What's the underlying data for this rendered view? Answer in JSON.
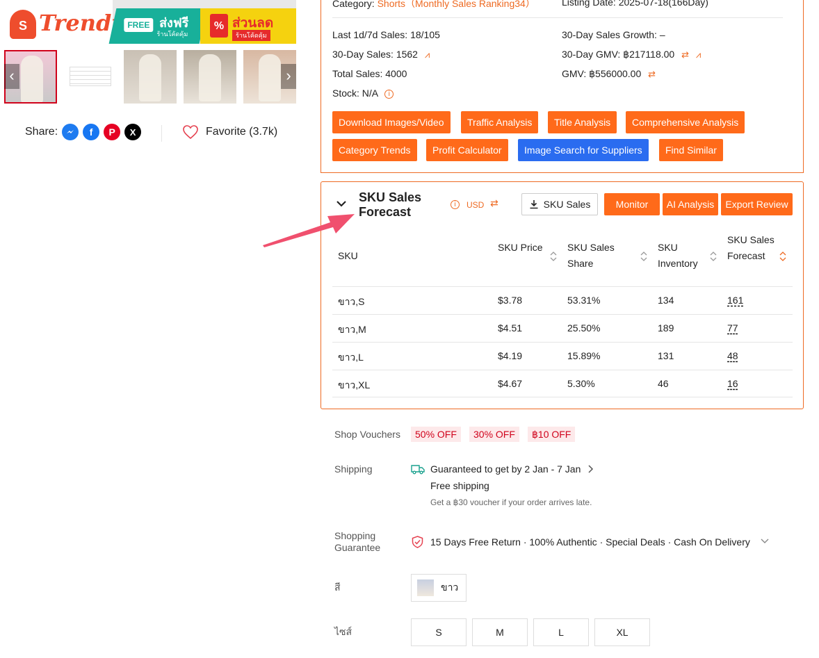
{
  "banner": {
    "brand_badge": "S",
    "brand_name": "Trendy",
    "free_tag": "FREE",
    "free_text": "ส่งฟรี",
    "free_sub": "ร้านโค้ดคุ้ม",
    "sale_icon": "%",
    "sale_text": "ส่วนลด",
    "sale_sub": "ร้านโค้ดคุ้ม"
  },
  "gallery": {
    "prev_icon": "chevron-left-icon",
    "next_icon": "chevron-right-icon",
    "prev_glyph": "‹",
    "next_glyph": "›"
  },
  "share": {
    "label": "Share:",
    "icons": [
      "messenger-icon",
      "facebook-icon",
      "pinterest-icon",
      "x-icon"
    ],
    "facebook_glyph": "f",
    "pinterest_glyph": "P",
    "x_glyph": "X"
  },
  "favorite": {
    "label": "Favorite (3.7k)"
  },
  "stats": {
    "category_label": "Category:",
    "category_value": "Shorts（Monthly Sales Ranking34）",
    "listing_label": "Listing Date:",
    "listing_value": "2025-07-18(166Day)",
    "last_sales": "Last 1d/7d Sales: 18/105",
    "growth": "30-Day Sales Growth: –",
    "sales_30": "30-Day Sales: 1562",
    "gmv_30": "30-Day GMV: ฿217118.00",
    "total_sales": "Total Sales: 4000",
    "gmv": "GMV: ฿556000.00",
    "stock": "Stock: N/A",
    "chart_glyph": "⩘",
    "swap_glyph": "⇄",
    "info_glyph": "i"
  },
  "actions": {
    "download": "Download Images/Video",
    "traffic": "Traffic Analysis",
    "title": "Title Analysis",
    "comprehensive": "Comprehensive Analysis",
    "category_trends": "Category Trends",
    "profit": "Profit Calculator",
    "image_search": "Image Search for Suppliers",
    "find_similar": "Find Similar"
  },
  "sku": {
    "title": "SKU Sales Forecast",
    "currency": "USD",
    "sales_button": "SKU Sales",
    "monitor": "Monitor",
    "ai": "AI Analysis",
    "export": "Export Review",
    "headers": [
      "SKU",
      "SKU Price",
      "SKU Sales Share",
      "SKU Inventory",
      "SKU Sales Forecast"
    ],
    "rows": [
      {
        "sku": "ขาว,S",
        "price": "$3.78",
        "share": "53.31%",
        "inventory": "134",
        "forecast": "161"
      },
      {
        "sku": "ขาว,M",
        "price": "$4.51",
        "share": "25.50%",
        "inventory": "189",
        "forecast": "77"
      },
      {
        "sku": "ขาว,L",
        "price": "$4.19",
        "share": "15.89%",
        "inventory": "131",
        "forecast": "48"
      },
      {
        "sku": "ขาว,XL",
        "price": "$4.67",
        "share": "5.30%",
        "inventory": "46",
        "forecast": "16"
      }
    ],
    "accent": "#ee6a22"
  },
  "product": {
    "vouchers_label": "Shop Vouchers",
    "vouchers": [
      "50% OFF",
      "30% OFF",
      "฿10 OFF"
    ],
    "shipping_label": "Shipping",
    "shipping_eta": "Guaranteed to get by 2 Jan - 7 Jan",
    "shipping_free": "Free shipping",
    "shipping_sub": "Get a ฿30 voucher if your order arrives late.",
    "guarantee_label": "Shopping Guarantee",
    "guarantee_text": "15 Days Free Return · 100% Authentic · Special Deals · Cash On Delivery",
    "color_label": "สี",
    "color_option": "ขาว",
    "size_label": "ไซส์",
    "sizes": [
      "S",
      "M",
      "L",
      "XL"
    ]
  },
  "colors": {
    "orange": "#ff6a1a",
    "blue": "#2a6cf0",
    "arrow": "#f0506e",
    "voucher_bg": "#fde9ea",
    "voucher_text": "#d0021b"
  }
}
